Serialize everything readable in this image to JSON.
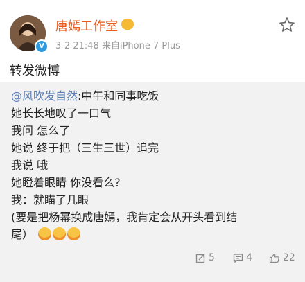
{
  "post": {
    "username": "唐嫣工作室",
    "meta": "3-2 21:48  来自iPhone 7 Plus",
    "repost_text": "转发微博"
  },
  "quoted": {
    "mention": "@风吹发自然",
    "first_line_rest": ":中午和同事吃饭",
    "lines": [
      "她长长地叹了一口气",
      "我问 怎么了",
      "她说 终于把（三生三世）追完",
      "我说 哦",
      "她瞪着眼睛 你没看么?",
      "我：就瞄了几眼",
      "(要是把杨幂换成唐嫣，我肯定会从开头看到结",
      "尾）"
    ]
  },
  "actions": {
    "repost_count": "5",
    "comment_count": "4",
    "like_count": "22"
  },
  "colors": {
    "username": "#e85a1e",
    "mention": "#5a7fb3",
    "verified": "#2e9ae0",
    "quoted_bg": "#f2f2f2"
  }
}
